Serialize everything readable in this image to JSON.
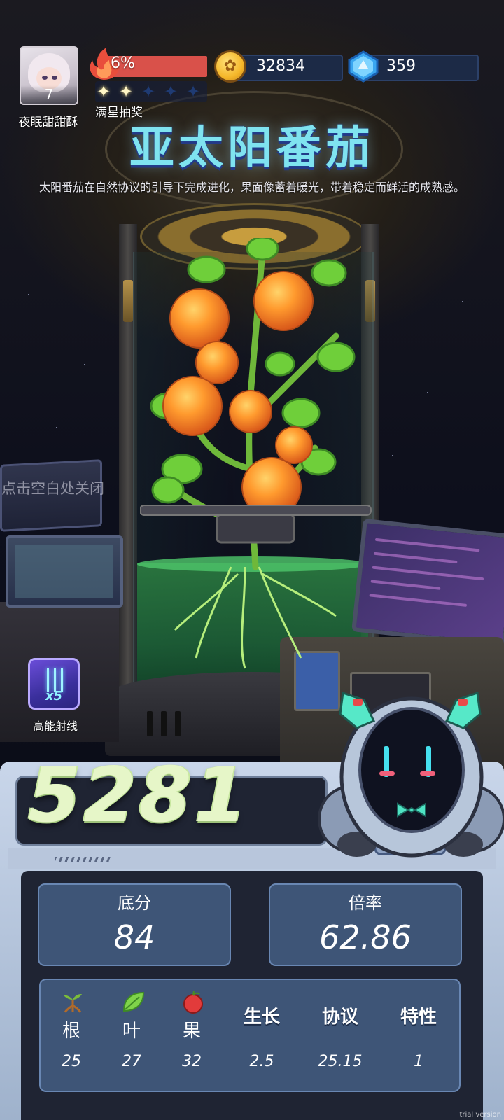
{
  "player": {
    "name": "夜眠甜甜酥",
    "level": "7"
  },
  "progress": {
    "percent_label": "6%",
    "stars_filled": 2,
    "stars_total": 5,
    "star_draw_label": "满星抽奖"
  },
  "currency": {
    "coins": "32834",
    "gems": "359"
  },
  "plant": {
    "title": "亚太阳番茄",
    "description": "太阳番茄在自然协议的引导下完成进化，果面像蓄着暖光，带着稳定而鲜活的成熟感。"
  },
  "close_hint": "点击空白处关闭",
  "skill": {
    "multiplier": "x5",
    "label": "高能射线"
  },
  "result": {
    "score": "5281",
    "base_label": "底分",
    "base_value": "84",
    "rate_label": "倍率",
    "rate_value": "62.86"
  },
  "attributes": [
    {
      "icon": "root-icon",
      "name": "根",
      "value": "25"
    },
    {
      "icon": "leaf-icon",
      "name": "叶",
      "value": "27"
    },
    {
      "icon": "fruit-icon",
      "name": "果",
      "value": "32"
    },
    {
      "name": "生长",
      "value": "2.5"
    },
    {
      "name": "协议",
      "value": "25.15"
    },
    {
      "name": "特性",
      "value": "1"
    }
  ],
  "watermark": "trial version",
  "colors": {
    "fire": "#d9514a",
    "title": "#7fe3f0",
    "card": "#3e5577",
    "panel": "#1f2433"
  }
}
